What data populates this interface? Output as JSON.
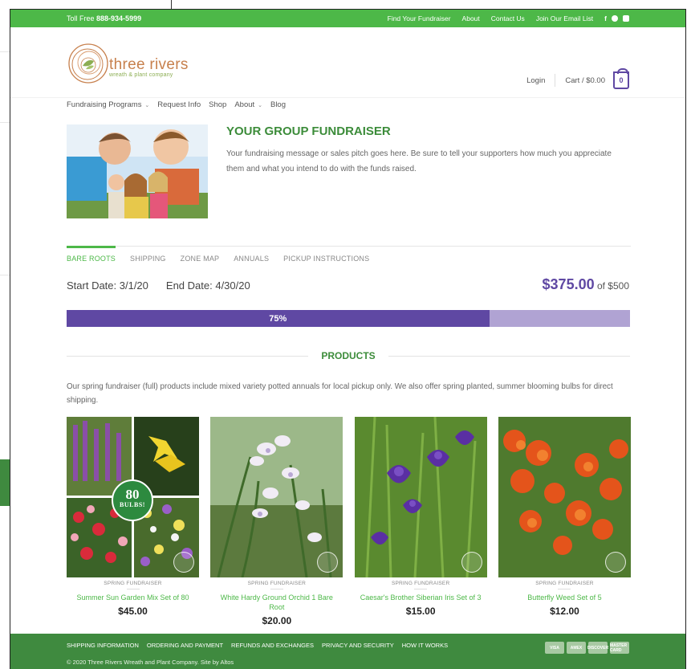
{
  "topbar": {
    "toll_free_label": "Toll Free",
    "toll_free_number": "888-934-5999",
    "links": [
      "Find Your Fundraiser",
      "About",
      "Contact Us",
      "Join Our Email List"
    ],
    "social": [
      "facebook-icon",
      "pinterest-icon",
      "instagram-icon"
    ]
  },
  "header": {
    "logo_name": "three rivers",
    "logo_sub": "wreath & plant company",
    "login": "Login",
    "cart": "Cart / $0.00",
    "cart_count": "0"
  },
  "nav": {
    "items": [
      "Fundraising Programs",
      "Request Info",
      "Shop",
      "About",
      "Blog"
    ]
  },
  "hero": {
    "title": "YOUR GROUP FUNDRAISER",
    "text": "Your fundraising message or sales pitch goes here. Be sure to tell your supporters how much you appreciate them and what you intend to do with the funds raised."
  },
  "tabs": [
    "BARE ROOTS",
    "SHIPPING",
    "ZONE MAP",
    "ANNUALS",
    "PICKUP INSTRUCTIONS"
  ],
  "campaign": {
    "start": "Start Date: 3/1/20",
    "end": "End Date: 4/30/20",
    "raised": "$375.00",
    "goal": "of $500",
    "progress_label": "75%",
    "progress_fraction": 0.75
  },
  "products": {
    "heading": "PRODUCTS",
    "description": "Our spring fundraiser (full) products include mixed variety potted annuals for local pickup only. We also offer spring planted, summer blooming bulbs for direct shipping.",
    "items": [
      {
        "category": "SPRING FUNDRAISER",
        "name": "Summer Sun Garden Mix Set of 80",
        "price": "$45.00",
        "badge_number": "80",
        "badge_word": "BULBS!"
      },
      {
        "category": "SPRING FUNDRAISER",
        "name": "White Hardy Ground Orchid 1 Bare Root",
        "price": "$20.00"
      },
      {
        "category": "SPRING FUNDRAISER",
        "name": "Caesar's Brother Siberian Iris Set of 3",
        "price": "$15.00"
      },
      {
        "category": "SPRING FUNDRAISER",
        "name": "Butterfly Weed Set of 5",
        "price": "$12.00"
      }
    ]
  },
  "footer": {
    "links": [
      "SHIPPING INFORMATION",
      "ORDERING AND PAYMENT",
      "REFUNDS AND EXCHANGES",
      "PRIVACY AND SECURITY",
      "HOW IT WORKS"
    ],
    "copyright": "© 2020 Three Rivers Wreath and Plant Company. Site by Altos",
    "payment_cards": [
      "VISA",
      "AMEX",
      "DISCOVER",
      "MASTER CARD"
    ]
  },
  "colors": {
    "brand_green": "#4db848",
    "dark_green": "#3f8a3f",
    "purple": "#5f48a3",
    "purple_light": "#b0a3d3"
  }
}
